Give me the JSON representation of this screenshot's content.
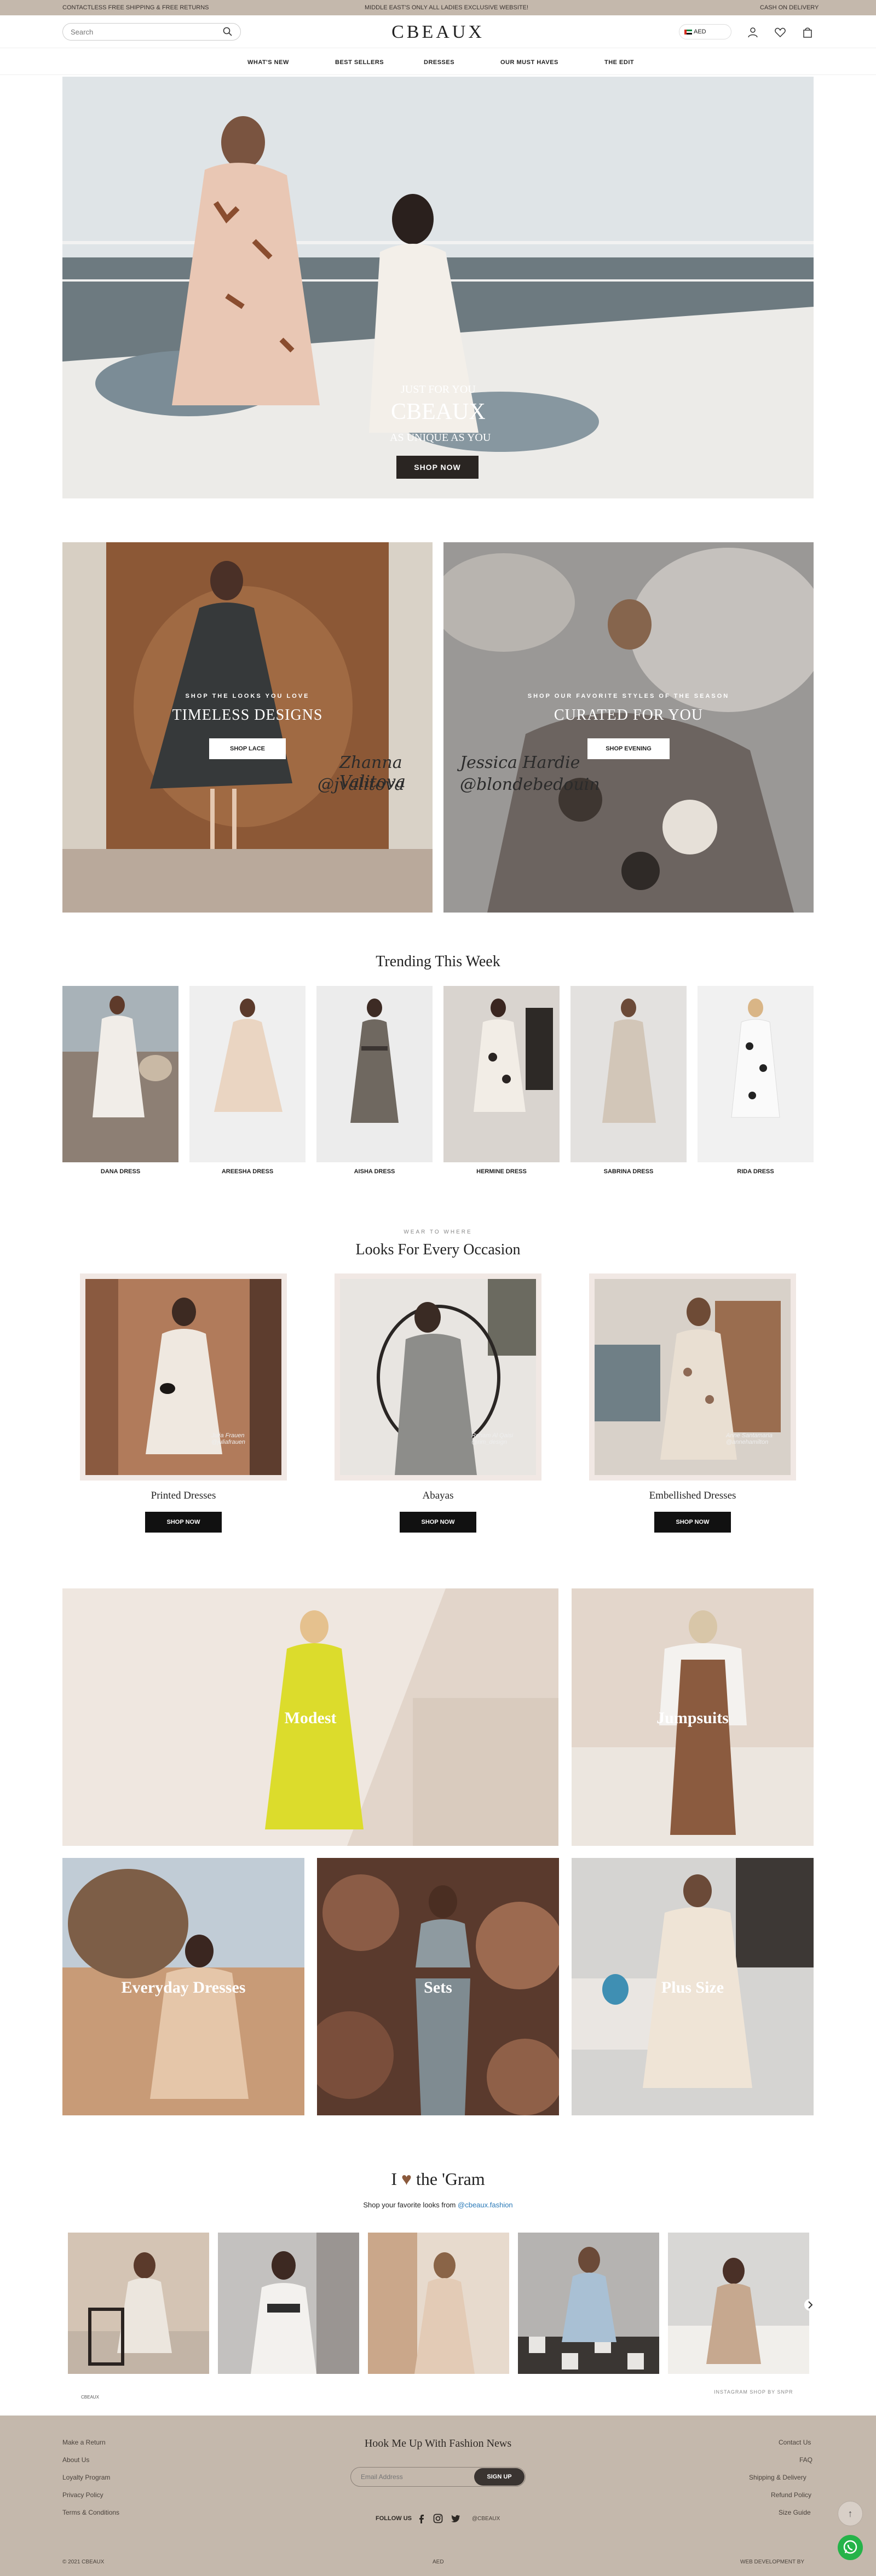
{
  "topbar": {
    "left": "CONTACTLESS FREE SHIPPING & FREE RETURNS",
    "center": "MIDDLE EAST'S ONLY ALL LADIES EXCLUSIVE WEBSITE!",
    "right": "CASH ON DELIVERY"
  },
  "header": {
    "search_placeholder": "Search",
    "logo": "CBEAUX",
    "currency": "AED",
    "icons": [
      "search-icon",
      "user-icon",
      "heart-icon",
      "bag-icon"
    ]
  },
  "nav": {
    "items": [
      "WHAT'S NEW",
      "BEST SELLERS",
      "DRESSES",
      "OUR MUST HAVES",
      "THE EDIT"
    ]
  },
  "hero": {
    "line1": "JUST FOR YOU",
    "brand": "CBEAUX",
    "line2": "AS UNIQUE AS YOU",
    "button": "SHOP NOW"
  },
  "promos": [
    {
      "kicker": "SHOP THE LOOKS YOU LOVE",
      "title": "TIMELESS DESIGNS",
      "button": "SHOP LACE",
      "signature1": "Zhanna Valitova",
      "signature2": "@jvalitova"
    },
    {
      "kicker": "SHOP OUR FAVORITE STYLES OF THE SEASON",
      "title": "CURATED FOR YOU",
      "button": "SHOP EVENING",
      "signature1": "Jessica Hardie",
      "signature2": "@blondebedouin"
    }
  ],
  "trending": {
    "title": "Trending This Week",
    "items": [
      "DANA DRESS",
      "AREESHA DRESS",
      "AISHA DRESS",
      "HERMINE DRESS",
      "SABRINA DRESS",
      "RIDA DRESS"
    ]
  },
  "occasion": {
    "kicker": "WEAR TO WHERE",
    "title": "Looks For Every Occasion",
    "items": [
      {
        "name": "Printed Dresses",
        "button": "SHOP NOW",
        "credit": "Julia Frauen @juliafrauen"
      },
      {
        "name": "Abayas",
        "button": "SHOP NOW",
        "credit": "Reham Al Qaisi @rim_design"
      },
      {
        "name": "Embellished Dresses",
        "button": "SHOP NOW",
        "credit": "Anne Santamaria @annehamilton"
      }
    ]
  },
  "categories": [
    "Modest",
    "Jumpsuits",
    "Everyday Dresses",
    "Sets",
    "Plus Size"
  ],
  "gram": {
    "title_pre": "I",
    "title_post": "the 'Gram",
    "subtitle_pre": "Shop your favorite looks from",
    "handle": "@cbeaux.fashion",
    "brand_small": "CBEAUX",
    "credit": "INSTAGRAM SHOP BY SNPR"
  },
  "footer": {
    "left_links": [
      "Make a Return",
      "About Us",
      "Loyalty Program",
      "Privacy Policy",
      "Terms & Conditions"
    ],
    "right_links": [
      "Contact Us",
      "FAQ",
      "Shipping & Delivery",
      "Refund Policy",
      "Size Guide"
    ],
    "title": "Hook Me Up With Fashion News",
    "email_placeholder": "Email Address",
    "signup": "SIGN UP",
    "follow": "FOLLOW US",
    "handle": "@CBEAUX",
    "copyright": "© 2021 CBEAUX",
    "currency": "AED",
    "credit": "WEB DEVELOPMENT BY"
  },
  "colors": {
    "accent": "#c4b8ac",
    "dark": "#2a2522",
    "link": "#2a7ab8",
    "whatsapp": "#25b349"
  }
}
